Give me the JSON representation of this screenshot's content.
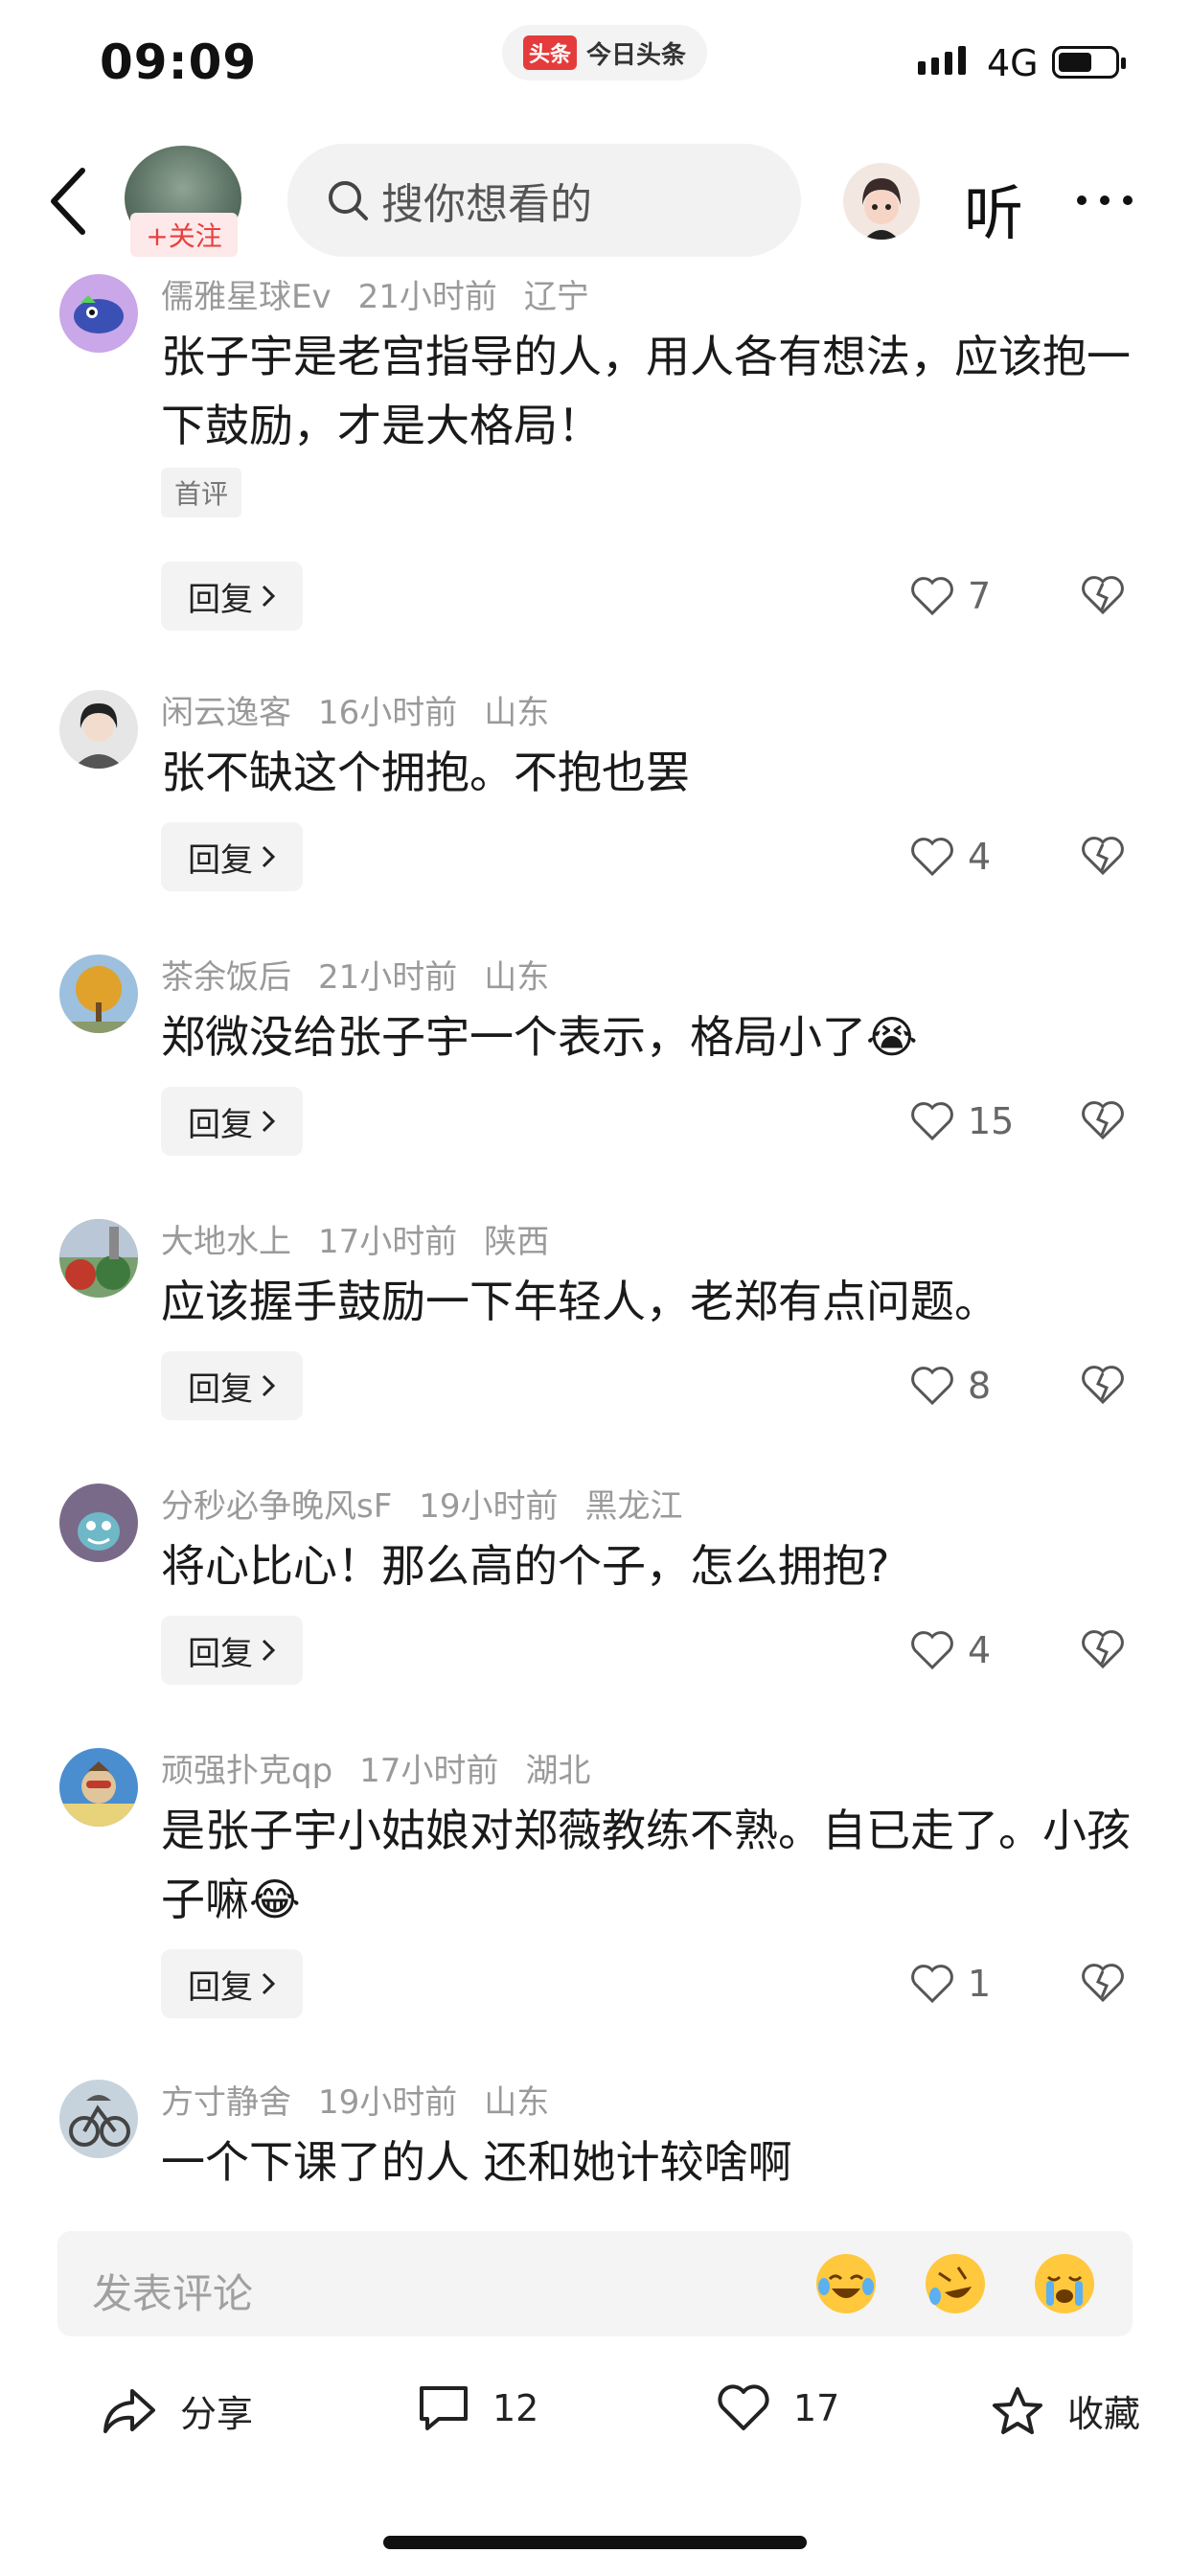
{
  "status_bar": {
    "time": "09:09",
    "center_logo": "头条",
    "center_app": "今日头条",
    "network": "4G"
  },
  "header": {
    "follow_label": "+关注",
    "search_placeholder": "搜你想看的",
    "listen_label": "听",
    "icons": [
      "back-icon",
      "search-icon",
      "more-icon"
    ]
  },
  "comments": [
    {
      "user": "儒雅星球Ev",
      "time": "21小时前",
      "location": "辽宁",
      "text": "张子宇是老宫指导的人，用人各有想法，应该抱一下鼓励，才是大格局！",
      "tag": "首评",
      "reply_label": "回复",
      "likes": "7"
    },
    {
      "user": "闲云逸客",
      "time": "16小时前",
      "location": "山东",
      "text": "张不缺这个拥抱。不抱也罢",
      "reply_label": "回复",
      "likes": "4"
    },
    {
      "user": "茶余饭后",
      "time": "21小时前",
      "location": "山东",
      "text": "郑微没给张子宇一个表示，格局小了😭",
      "reply_label": "回复",
      "likes": "15"
    },
    {
      "user": "大地水上",
      "time": "17小时前",
      "location": "陕西",
      "text": "应该握手鼓励一下年轻人，老郑有点问题。",
      "reply_label": "回复",
      "likes": "8"
    },
    {
      "user": "分秒必争晚风sF",
      "time": "19小时前",
      "location": "黑龙江",
      "text": "将心比心！那么高的个子，怎么拥抱?",
      "reply_label": "回复",
      "likes": "4"
    },
    {
      "user": "顽强扑克qp",
      "time": "17小时前",
      "location": "湖北",
      "text": "是张子宇小姑娘对郑薇教练不熟。自已走了。小孩子嘛😂",
      "reply_label": "回复",
      "likes": "1"
    },
    {
      "user": "方寸静舍",
      "time": "19小时前",
      "location": "山东",
      "text": "一个下课了的人 还和她计较啥啊"
    }
  ],
  "comment_bar": {
    "placeholder": "发表评论"
  },
  "action_bar": {
    "share_label": "分享",
    "comment_count": "12",
    "like_count": "17",
    "favorite_label": "收藏"
  },
  "colors": {
    "accent_red": "#e84040",
    "meta_gray": "#9a9a9a"
  }
}
